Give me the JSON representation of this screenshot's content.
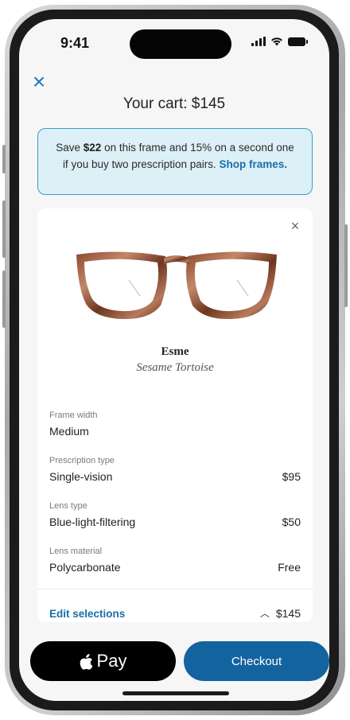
{
  "status_bar": {
    "time": "9:41"
  },
  "header": {
    "title": "Your cart: $145"
  },
  "promo": {
    "text_before": "Save ",
    "amount": "$22",
    "text_after": " on this frame and 15% on a second one if you buy two prescription pairs. ",
    "link": "Shop frames."
  },
  "item": {
    "name": "Esme",
    "color": "Sesame Tortoise",
    "specs": [
      {
        "label": "Frame width",
        "value": "Medium",
        "price": ""
      },
      {
        "label": "Prescription type",
        "value": "Single-vision",
        "price": "$95"
      },
      {
        "label": "Lens type",
        "value": "Blue-light-filtering",
        "price": "$50"
      },
      {
        "label": "Lens material",
        "value": "Polycarbonate",
        "price": "Free"
      }
    ],
    "edit_label": "Edit selections",
    "total": "$145"
  },
  "actions": {
    "pay_label": "Pay",
    "checkout_label": "Checkout"
  },
  "colors": {
    "accent": "#1e78c2",
    "checkout": "#13639f",
    "promo_bg": "#dcf0f7"
  }
}
